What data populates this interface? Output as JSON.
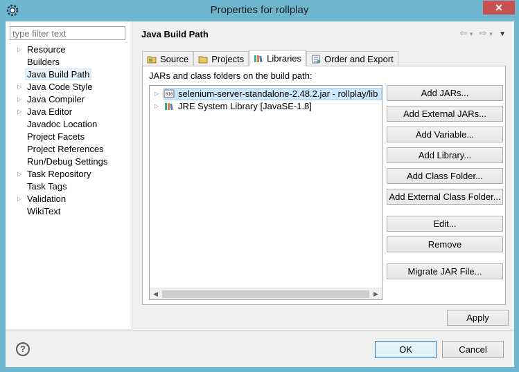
{
  "window": {
    "title": "Properties for rollplay",
    "close_glyph": "✕",
    "app_icon": "eclipse-gear-icon"
  },
  "sidebar": {
    "filter_placeholder": "type filter text",
    "items": [
      {
        "label": "Resource",
        "expandable": true
      },
      {
        "label": "Builders",
        "expandable": false
      },
      {
        "label": "Java Build Path",
        "expandable": false,
        "selected": true
      },
      {
        "label": "Java Code Style",
        "expandable": true
      },
      {
        "label": "Java Compiler",
        "expandable": true
      },
      {
        "label": "Java Editor",
        "expandable": true
      },
      {
        "label": "Javadoc Location",
        "expandable": false
      },
      {
        "label": "Project Facets",
        "expandable": false
      },
      {
        "label": "Project References",
        "expandable": false
      },
      {
        "label": "Run/Debug Settings",
        "expandable": false
      },
      {
        "label": "Task Repository",
        "expandable": true
      },
      {
        "label": "Task Tags",
        "expandable": false
      },
      {
        "label": "Validation",
        "expandable": true
      },
      {
        "label": "WikiText",
        "expandable": false
      }
    ]
  },
  "page": {
    "title": "Java Build Path",
    "tabs": [
      {
        "label": "Source",
        "icon": "source-folder-icon"
      },
      {
        "label": "Projects",
        "icon": "projects-icon"
      },
      {
        "label": "Libraries",
        "icon": "libraries-icon",
        "active": true
      },
      {
        "label": "Order and Export",
        "icon": "order-export-icon"
      }
    ],
    "panel_label": "JARs and class folders on the build path:",
    "entries": [
      {
        "label": "selenium-server-standalone-2.48.2.jar - rollplay/lib",
        "icon": "jar-icon",
        "selected": true
      },
      {
        "label": "JRE System Library [JavaSE-1.8]",
        "icon": "library-icon",
        "selected": false
      }
    ],
    "buttons": {
      "add_jars": "Add JARs...",
      "add_external_jars": "Add External JARs...",
      "add_variable": "Add Variable...",
      "add_library": "Add Library...",
      "add_class_folder": "Add Class Folder...",
      "add_external_class_folder": "Add External Class Folder...",
      "edit": "Edit...",
      "remove": "Remove",
      "migrate_jar": "Migrate JAR File..."
    },
    "apply": "Apply"
  },
  "footer": {
    "help_glyph": "?",
    "ok": "OK",
    "cancel": "Cancel"
  }
}
